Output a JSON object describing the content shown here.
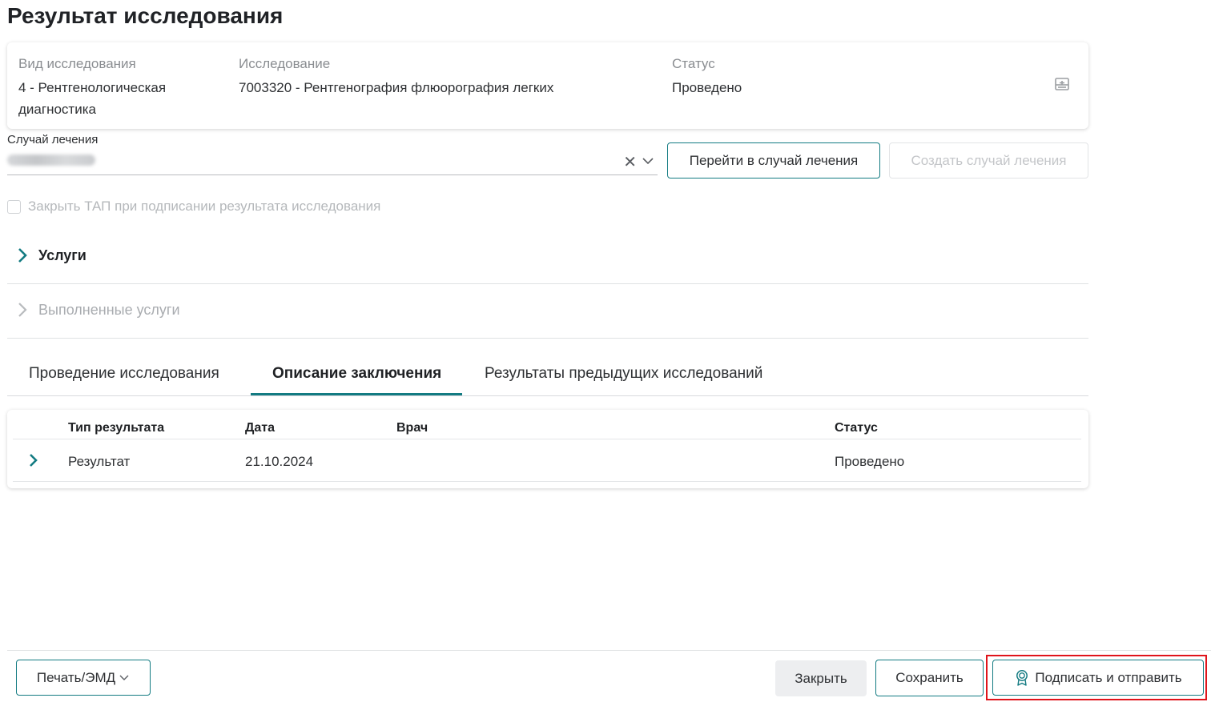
{
  "page": {
    "title": "Результат исследования"
  },
  "info": {
    "type_label": "Вид исследования",
    "type_value_line1": "4 - Рентгенологическая",
    "type_value_line2": "диагностика",
    "study_label": "Исследование",
    "study_value": "7003320 - Рентгенография флюорография легких",
    "status_label": "Статус",
    "status_value": "Проведено",
    "icon": "scanner-icon"
  },
  "case": {
    "label": "Случай лечения",
    "clear_glyph": "✕",
    "goto_button": "Перейти в случай лечения",
    "create_button": "Создать случай лечения"
  },
  "checkbox": {
    "label": "Закрыть ТАП при подписании результата исследования",
    "checked": false
  },
  "sections": [
    {
      "label": "Услуги",
      "enabled": true
    },
    {
      "label": "Выполненные услуги",
      "enabled": false
    }
  ],
  "tabs": [
    {
      "label": "Проведение исследования",
      "active": false
    },
    {
      "label": "Описание заключения",
      "active": true
    },
    {
      "label": "Результаты предыдущих исследований",
      "active": false
    }
  ],
  "table": {
    "columns": [
      "Тип результата",
      "Дата",
      "Врач",
      "Статус"
    ],
    "rows": [
      {
        "type": "Результат",
        "date": "21.10.2024",
        "doctor": "",
        "status": "Проведено"
      }
    ]
  },
  "footer": {
    "print_button": "Печать/ЭМД",
    "close_button": "Закрыть",
    "save_button": "Сохранить",
    "sign_button": "Подписать и отправить"
  },
  "colors": {
    "accent": "#137b82",
    "highlight": "#e0141b"
  }
}
